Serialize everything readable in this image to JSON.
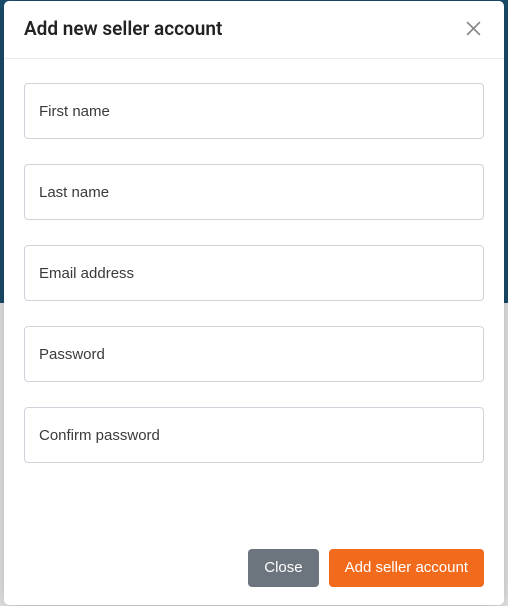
{
  "modal": {
    "title": "Add new seller account",
    "fields": {
      "first_name": {
        "placeholder": "First name",
        "value": ""
      },
      "last_name": {
        "placeholder": "Last name",
        "value": ""
      },
      "email": {
        "placeholder": "Email address",
        "value": ""
      },
      "password": {
        "placeholder": "Password",
        "value": ""
      },
      "confirm_password": {
        "placeholder": "Confirm password",
        "value": ""
      }
    },
    "buttons": {
      "close": "Close",
      "submit": "Add seller account"
    }
  },
  "colors": {
    "primary": "#f26b1d",
    "secondary": "#6c757d",
    "border": "#ced4da"
  }
}
